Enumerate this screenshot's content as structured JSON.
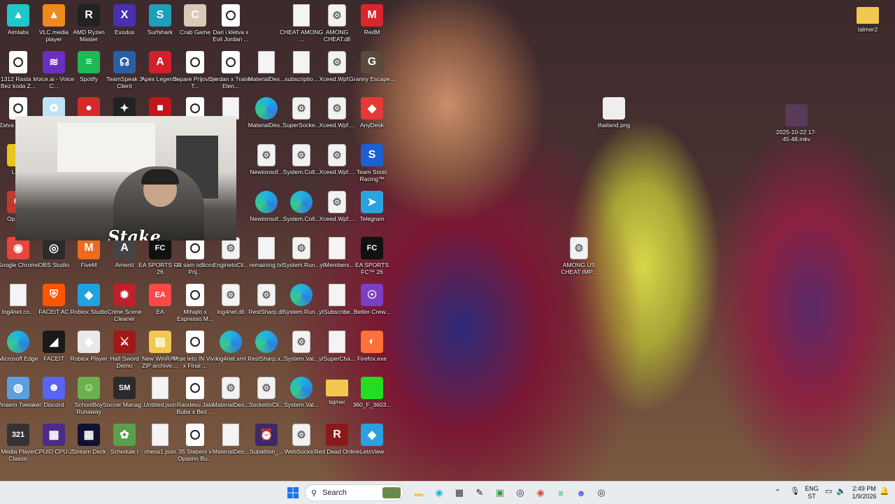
{
  "desktop": {
    "icons": [
      {
        "label": "Aimlabs",
        "icon": "aimlabs-icon",
        "color": "#1dc8c8",
        "glyph": "▲"
      },
      {
        "label": "VLC media player",
        "icon": "vlc-icon",
        "color": "#f08a1d",
        "glyph": "▲"
      },
      {
        "label": "AMD Ryzen Master",
        "icon": "ryzen-master-icon",
        "color": "#222222",
        "glyph": "R"
      },
      {
        "label": "Exodus",
        "icon": "exodus-icon",
        "color": "#4a2fb0",
        "glyph": "X"
      },
      {
        "label": "Surfshark",
        "icon": "surfshark-icon",
        "color": "#1c9fb8",
        "glyph": "S"
      },
      {
        "label": "Crab Game",
        "icon": "crab-game-icon",
        "color": "#d7c9b6",
        "glyph": "C"
      },
      {
        "label": "Dari i kletva x Evil Jordan ...",
        "icon": "video-file-icon"
      },
      {
        "label": "CHEAT AMONG ...",
        "icon": "text-file-icon"
      },
      {
        "label": "AMONG CHEAT.dll",
        "icon": "dll-file-icon"
      },
      {
        "label": "RedM",
        "icon": "redm-icon",
        "color": "#d9262c",
        "glyph": "M"
      },
      {
        "label": "1312 Rasta x Bez koda Z...",
        "icon": "video-file-icon"
      },
      {
        "label": "Voice.ai - Voice C...",
        "icon": "voiceai-icon",
        "color": "#6b2fc0",
        "glyph": "≋"
      },
      {
        "label": "Spotify",
        "icon": "spotify-icon",
        "color": "#1db954",
        "glyph": "≡"
      },
      {
        "label": "TeamSpeak 3 Client",
        "icon": "teamspeak-icon",
        "color": "#2a5fa8",
        "glyph": "☊"
      },
      {
        "label": "Apex Legends",
        "icon": "apex-icon",
        "color": "#d4202a",
        "glyph": "A"
      },
      {
        "label": "Separe Prijovic x T...",
        "icon": "video-file-icon"
      },
      {
        "label": "Djerdan x Tralala Elen...",
        "icon": "video-file-icon"
      },
      {
        "label": "MaterialDes...",
        "icon": "text-file-icon"
      },
      {
        "label": "subscriptio...",
        "icon": "text-file-icon"
      },
      {
        "label": "Xceed.Wpf....",
        "icon": "dll-file-icon"
      },
      {
        "label": "Granny Escape...",
        "icon": "granny-icon",
        "color": "#5a4a3a",
        "glyph": "G"
      },
      {
        "label": "Zatva Dirty c...",
        "icon": "video-file-icon"
      },
      {
        "label": "",
        "icon": "recycle-bin-icon",
        "color": "#bfe3f5",
        "glyph": "♻"
      },
      {
        "label": "",
        "icon": "among-us-icon",
        "color": "#d42a2a",
        "glyph": "●"
      },
      {
        "label": "",
        "icon": "app-icon",
        "color": "#222222",
        "glyph": "✦"
      },
      {
        "label": "",
        "icon": "app-icon",
        "color": "#c4151c",
        "glyph": "■"
      },
      {
        "label": "",
        "icon": "video-file-icon"
      },
      {
        "label": "",
        "icon": "text-file-icon"
      },
      {
        "label": "MaterialDes...",
        "icon": "edge-file-icon"
      },
      {
        "label": "SuperSocke...",
        "icon": "dll-file-icon"
      },
      {
        "label": "Xceed.Wpf....",
        "icon": "dll-file-icon"
      },
      {
        "label": "AnyDesk",
        "icon": "anydesk-icon",
        "color": "#e53935",
        "glyph": "◆"
      },
      {
        "label": "Leve",
        "icon": "app-icon",
        "color": "#e8c61a",
        "glyph": "L"
      },
      {
        "label": "Newtonsof...",
        "icon": "dll-file-icon"
      },
      {
        "label": "System.Coll...",
        "icon": "dll-file-icon"
      },
      {
        "label": "Xceed.Wpf....",
        "icon": "dll-file-icon"
      },
      {
        "label": "Team Sonic Racing™",
        "icon": "sonic-icon",
        "color": "#1e5fd0",
        "glyph": "S"
      },
      {
        "label": "Ope Bro",
        "icon": "app-icon",
        "color": "#c0392b",
        "glyph": "O"
      },
      {
        "label": "Newtonsof...",
        "icon": "edge-file-icon"
      },
      {
        "label": "System.Coll...",
        "icon": "edge-file-icon"
      },
      {
        "label": "Xceed.Wpf....",
        "icon": "dll-file-icon"
      },
      {
        "label": "Telegram",
        "icon": "telegram-icon",
        "color": "#2aa3de",
        "glyph": "➤"
      },
      {
        "label": "Google Chrome",
        "icon": "chrome-icon",
        "color": "#e8453c",
        "glyph": "◉"
      },
      {
        "label": "OBS Studio",
        "icon": "obs-icon",
        "color": "#2b2b2b",
        "glyph": "◎"
      },
      {
        "label": "FiveM",
        "icon": "fivem-icon",
        "color": "#f06a1d",
        "glyph": "M"
      },
      {
        "label": "Amenti",
        "icon": "app-icon",
        "color": "#444444",
        "glyph": "A"
      },
      {
        "label": "EA SPORTS FC 26",
        "icon": "fc26-icon",
        "color": "#111111",
        "glyph": "FC"
      },
      {
        "label": "Ja sam odlicno Prij...",
        "icon": "video-file-icon"
      },
      {
        "label": "EngineIoCli...",
        "icon": "dll-file-icon"
      },
      {
        "label": "remaining.txt",
        "icon": "text-file-icon"
      },
      {
        "label": "System.Run...",
        "icon": "dll-file-icon"
      },
      {
        "label": "ytMembers...",
        "icon": "text-file-icon"
      },
      {
        "label": "EA SPORTS FC™ 26",
        "icon": "fc26-icon",
        "color": "#111111",
        "glyph": "FC"
      },
      {
        "label": "log4net.co...",
        "icon": "text-file-icon"
      },
      {
        "label": "FACEIT AC",
        "icon": "faceit-ac-icon",
        "color": "#ff5500",
        "glyph": "⛨"
      },
      {
        "label": "Roblox Studio",
        "icon": "roblox-studio-icon",
        "color": "#1fa2e0",
        "glyph": "◆"
      },
      {
        "label": "Crime Scene Cleaner",
        "icon": "crime-scene-icon",
        "color": "#c0202a",
        "glyph": "✹"
      },
      {
        "label": "EA",
        "icon": "ea-icon",
        "color": "#ff4747",
        "glyph": "EA"
      },
      {
        "label": "Mihajlo x Espresso M...",
        "icon": "video-file-icon"
      },
      {
        "label": "log4net.dll",
        "icon": "dll-file-icon"
      },
      {
        "label": "RestSharp.dll",
        "icon": "dll-file-icon"
      },
      {
        "label": "System.Run...",
        "icon": "edge-file-icon"
      },
      {
        "label": "ytSubscribe...",
        "icon": "text-file-icon"
      },
      {
        "label": "Better-Crew...",
        "icon": "better-crew-icon",
        "color": "#7b3fc4",
        "glyph": "☉"
      },
      {
        "label": "Microsoft Edge",
        "icon": "edge-icon"
      },
      {
        "label": "FACEIT",
        "icon": "faceit-icon",
        "color": "#1a1a1a",
        "glyph": "◢"
      },
      {
        "label": "Roblox Player",
        "icon": "roblox-icon",
        "color": "#e8e8e8",
        "glyph": "◆"
      },
      {
        "label": "Half Sword Demo",
        "icon": "half-sword-icon",
        "color": "#a01818",
        "glyph": "⚔"
      },
      {
        "label": "New WinRAR ZIP archive....",
        "icon": "winrar-icon",
        "color": "#f3c84f",
        "glyph": "▤"
      },
      {
        "label": "Moje leto IN Vivo x Final ...",
        "icon": "video-file-icon"
      },
      {
        "label": "log4net.xml",
        "icon": "edge-file-icon"
      },
      {
        "label": "RestSharp.x...",
        "icon": "edge-file-icon"
      },
      {
        "label": "System.Val...",
        "icon": "dll-file-icon"
      },
      {
        "label": "ytSuperCha...",
        "icon": "text-file-icon"
      },
      {
        "label": "Firefox.exe",
        "icon": "firefox-icon",
        "color": "#ff7139",
        "glyph": "◐"
      },
      {
        "label": "Winaero Tweaker",
        "icon": "winaero-icon",
        "color": "#5aa0e0",
        "glyph": "◍"
      },
      {
        "label": "Discord",
        "icon": "discord-icon",
        "color": "#5865f2",
        "glyph": "☻"
      },
      {
        "label": "SchoolBoy Runaway",
        "icon": "schoolboy-icon",
        "color": "#6ab04c",
        "glyph": "☺"
      },
      {
        "label": "Soccer Manag...",
        "icon": "soccer-manager-icon",
        "color": "#2b2b2b",
        "glyph": "SM"
      },
      {
        "label": "Untitled.json",
        "icon": "text-file-icon"
      },
      {
        "label": "Randevu Jala Buba x Bez ...",
        "icon": "video-file-icon"
      },
      {
        "label": "MaterialDes...",
        "icon": "dll-file-icon"
      },
      {
        "label": "SocketIoCli...",
        "icon": "dll-file-icon"
      },
      {
        "label": "System.Val...",
        "icon": "edge-file-icon"
      },
      {
        "label": "tajmer",
        "icon": "folder-icon"
      },
      {
        "label": "360_F_3603...",
        "icon": "image-file-icon",
        "color": "#22dd22",
        "glyph": ""
      },
      {
        "label": "Media Player Classic",
        "icon": "mpc-icon",
        "color": "#333333",
        "glyph": "321"
      },
      {
        "label": "CPUID CPU-Z",
        "icon": "cpuz-icon",
        "color": "#4b2a8a",
        "glyph": "▦"
      },
      {
        "label": "Stream Deck",
        "icon": "stream-deck-icon",
        "color": "#111133",
        "glyph": "▦"
      },
      {
        "label": "Schedule I",
        "icon": "schedule-icon",
        "color": "#5aa04a",
        "glyph": "✿"
      },
      {
        "label": "chesa1.json",
        "icon": "text-file-icon"
      },
      {
        "label": "35 Stepeni x Opasno Bu...",
        "icon": "video-file-icon"
      },
      {
        "label": "MaterialDes...",
        "icon": "text-file-icon"
      },
      {
        "label": "Subathon_...",
        "icon": "subathon-icon",
        "color": "#3a2a6a",
        "glyph": "⏰"
      },
      {
        "label": "WebSocke...",
        "icon": "dll-file-icon"
      },
      {
        "label": "Red Dead Online",
        "icon": "red-dead-icon",
        "color": "#8a1a1a",
        "glyph": "R"
      },
      {
        "label": "LetsView",
        "icon": "letsview-icon",
        "color": "#2aa0e0",
        "glyph": "◈"
      },
      {
        "label": "talmer2",
        "icon": "folder-icon"
      },
      {
        "label": "thailand.png",
        "icon": "image-file-icon",
        "color": "#eeeeee",
        "glyph": ""
      },
      {
        "label": "2025-10-22 17-45-48.mkv",
        "icon": "video-thumbnail-icon",
        "color": "#5a3a5a",
        "glyph": ""
      },
      {
        "label": "AMONG US CHEAT IMP...",
        "icon": "dll-file-icon"
      }
    ]
  },
  "webcam": {
    "overlay_text": "Stake",
    "overlay_sub": "com"
  },
  "taskbar": {
    "search_placeholder": "Search",
    "pinned": [
      {
        "icon": "file-explorer-icon",
        "color": "#f3c84f",
        "glyph": "▬"
      },
      {
        "icon": "edge-icon",
        "color": "#1fb4e0",
        "glyph": "◉"
      },
      {
        "icon": "store-icon",
        "color": "#333333",
        "glyph": "▦"
      },
      {
        "icon": "pen-app-icon",
        "color": "#222222",
        "glyph": "✎"
      },
      {
        "icon": "minecraft-icon",
        "color": "#3a9a3a",
        "glyph": "▣"
      },
      {
        "icon": "steam-icon",
        "color": "#1b2838",
        "glyph": "◎"
      },
      {
        "icon": "chrome-icon",
        "color": "#e8453c",
        "glyph": "◉"
      },
      {
        "icon": "spotify-icon",
        "color": "#1db954",
        "glyph": "≡"
      },
      {
        "icon": "discord-icon",
        "color": "#5865f2",
        "glyph": "☻"
      },
      {
        "icon": "obs-icon",
        "color": "#2b2b2b",
        "glyph": "◎"
      }
    ],
    "language_top": "ENG",
    "language_bottom": "ST",
    "time": "2:49 PM",
    "date": "1/9/2026"
  }
}
